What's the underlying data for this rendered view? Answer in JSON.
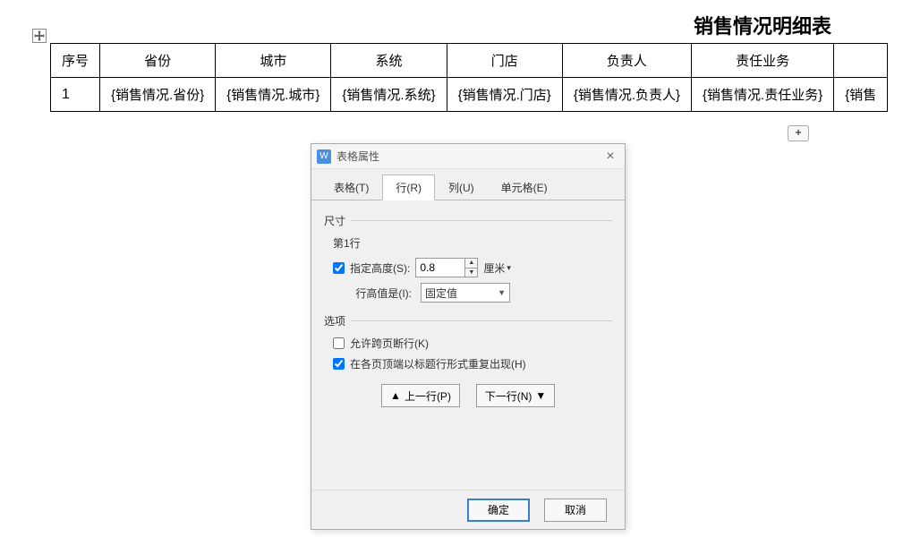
{
  "document": {
    "title": "销售情况明细表",
    "add_row_label": "+"
  },
  "table": {
    "headers": [
      "序号",
      "省份",
      "城市",
      "系统",
      "门店",
      "负责人",
      "责任业务",
      ""
    ],
    "rows": [
      {
        "seq": "1",
        "cells": [
          "{销售情况.省份}",
          "{销售情况.城市}",
          "{销售情况.系统}",
          "{销售情况.门店}",
          "{销售情况.负责人}",
          "{销售情况.责任业务}",
          "{销售"
        ]
      }
    ]
  },
  "dialog": {
    "title": "表格属性",
    "tabs": [
      {
        "label": "表格(T)"
      },
      {
        "label": "行(R)"
      },
      {
        "label": "列(U)"
      },
      {
        "label": "单元格(E)"
      }
    ],
    "active_tab": 1,
    "size_group": "尺寸",
    "row_label": "第1行",
    "height_checkbox_label": "指定高度(S):",
    "height_checked": true,
    "height_value": "0.8",
    "height_unit": "厘米",
    "row_height_type_label": "行高值是(I):",
    "row_height_type_value": "固定值",
    "options_group": "选项",
    "allow_break_label": "允许跨页断行(K)",
    "allow_break_checked": false,
    "repeat_header_label": "在各页顶端以标题行形式重复出现(H)",
    "repeat_header_checked": true,
    "prev_row_label": "上一行(P)",
    "next_row_label": "下一行(N)",
    "ok_label": "确定",
    "cancel_label": "取消"
  }
}
